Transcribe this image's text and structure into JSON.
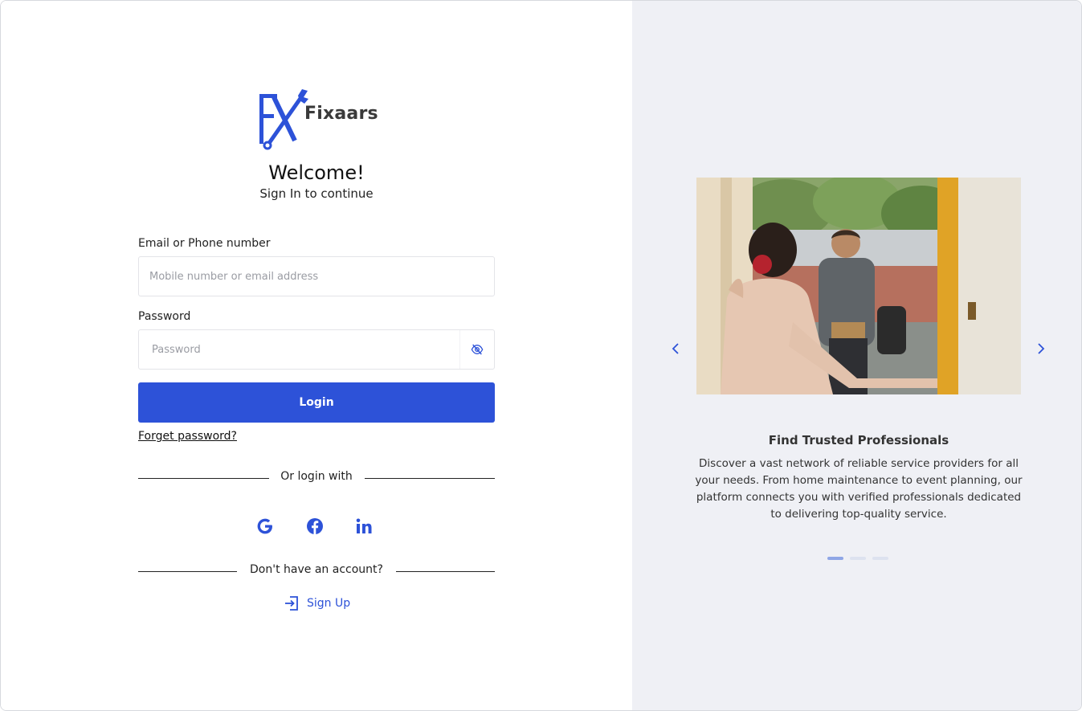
{
  "brand": {
    "name": "Fixaars",
    "mark": "FX",
    "accent": "#2d52d8"
  },
  "header": {
    "title": "Welcome!",
    "subtitle": "Sign In to continue"
  },
  "form": {
    "email_label": "Email or Phone number",
    "email_placeholder": "Mobile number or email address",
    "password_label": "Password",
    "password_placeholder": "Password",
    "eye_icon": "eye-off-icon",
    "login_label": "Login",
    "forget_label": "Forget password?"
  },
  "social": {
    "divider_text": "Or login with",
    "providers": [
      "google",
      "facebook",
      "linkedin"
    ]
  },
  "signup": {
    "divider_text": "Don't have an account?",
    "label": "Sign Up",
    "icon": "sign-in-icon"
  },
  "carousel": {
    "title": "Find Trusted Professionals",
    "description": "Discover a vast network of reliable service providers for all your needs. From home maintenance to event planning, our platform connects you with verified professionals dedicated to delivering top-quality service.",
    "slide_count": 3,
    "active_index": 0
  }
}
